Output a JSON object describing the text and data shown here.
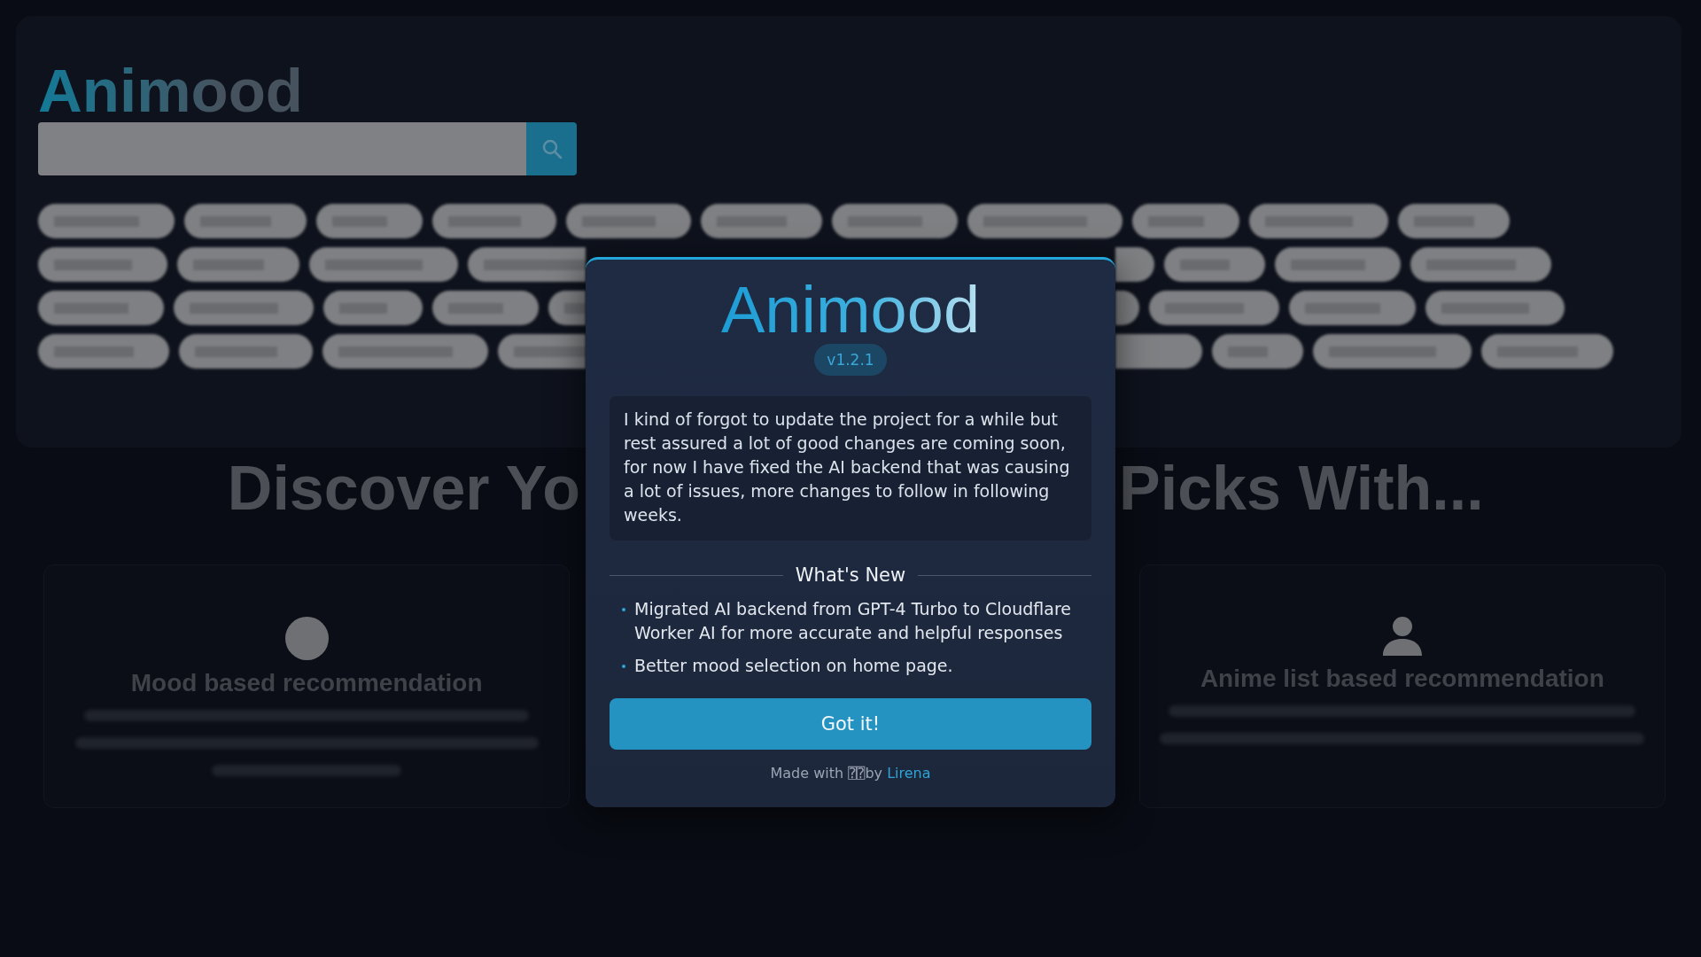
{
  "background_page": {
    "logo": "Animood",
    "heading_left": "Discover Yo",
    "heading_right": "Picks With...",
    "features": [
      {
        "kind": "mood",
        "title": "Mood based recommendation"
      },
      {
        "kind": "list",
        "title": "Anime list based recommendation"
      }
    ]
  },
  "modal": {
    "title": "Animood",
    "version": "v1.2.1",
    "message": "I kind of forgot to update the project for a while but rest assured a lot of good changes are coming soon, for now I have fixed the AI backend that was causing a lot of issues, more changes to follow in following weeks.",
    "section_title": "What's New",
    "changes": [
      "Migrated AI backend from GPT-4 Turbo to Cloudflare Worker AI for more accurate and helpful responses",
      "Better mood selection on home page."
    ],
    "button": "Got it!",
    "footer": {
      "text": "Made with ⍰⍰by",
      "link": "Lirena"
    }
  }
}
